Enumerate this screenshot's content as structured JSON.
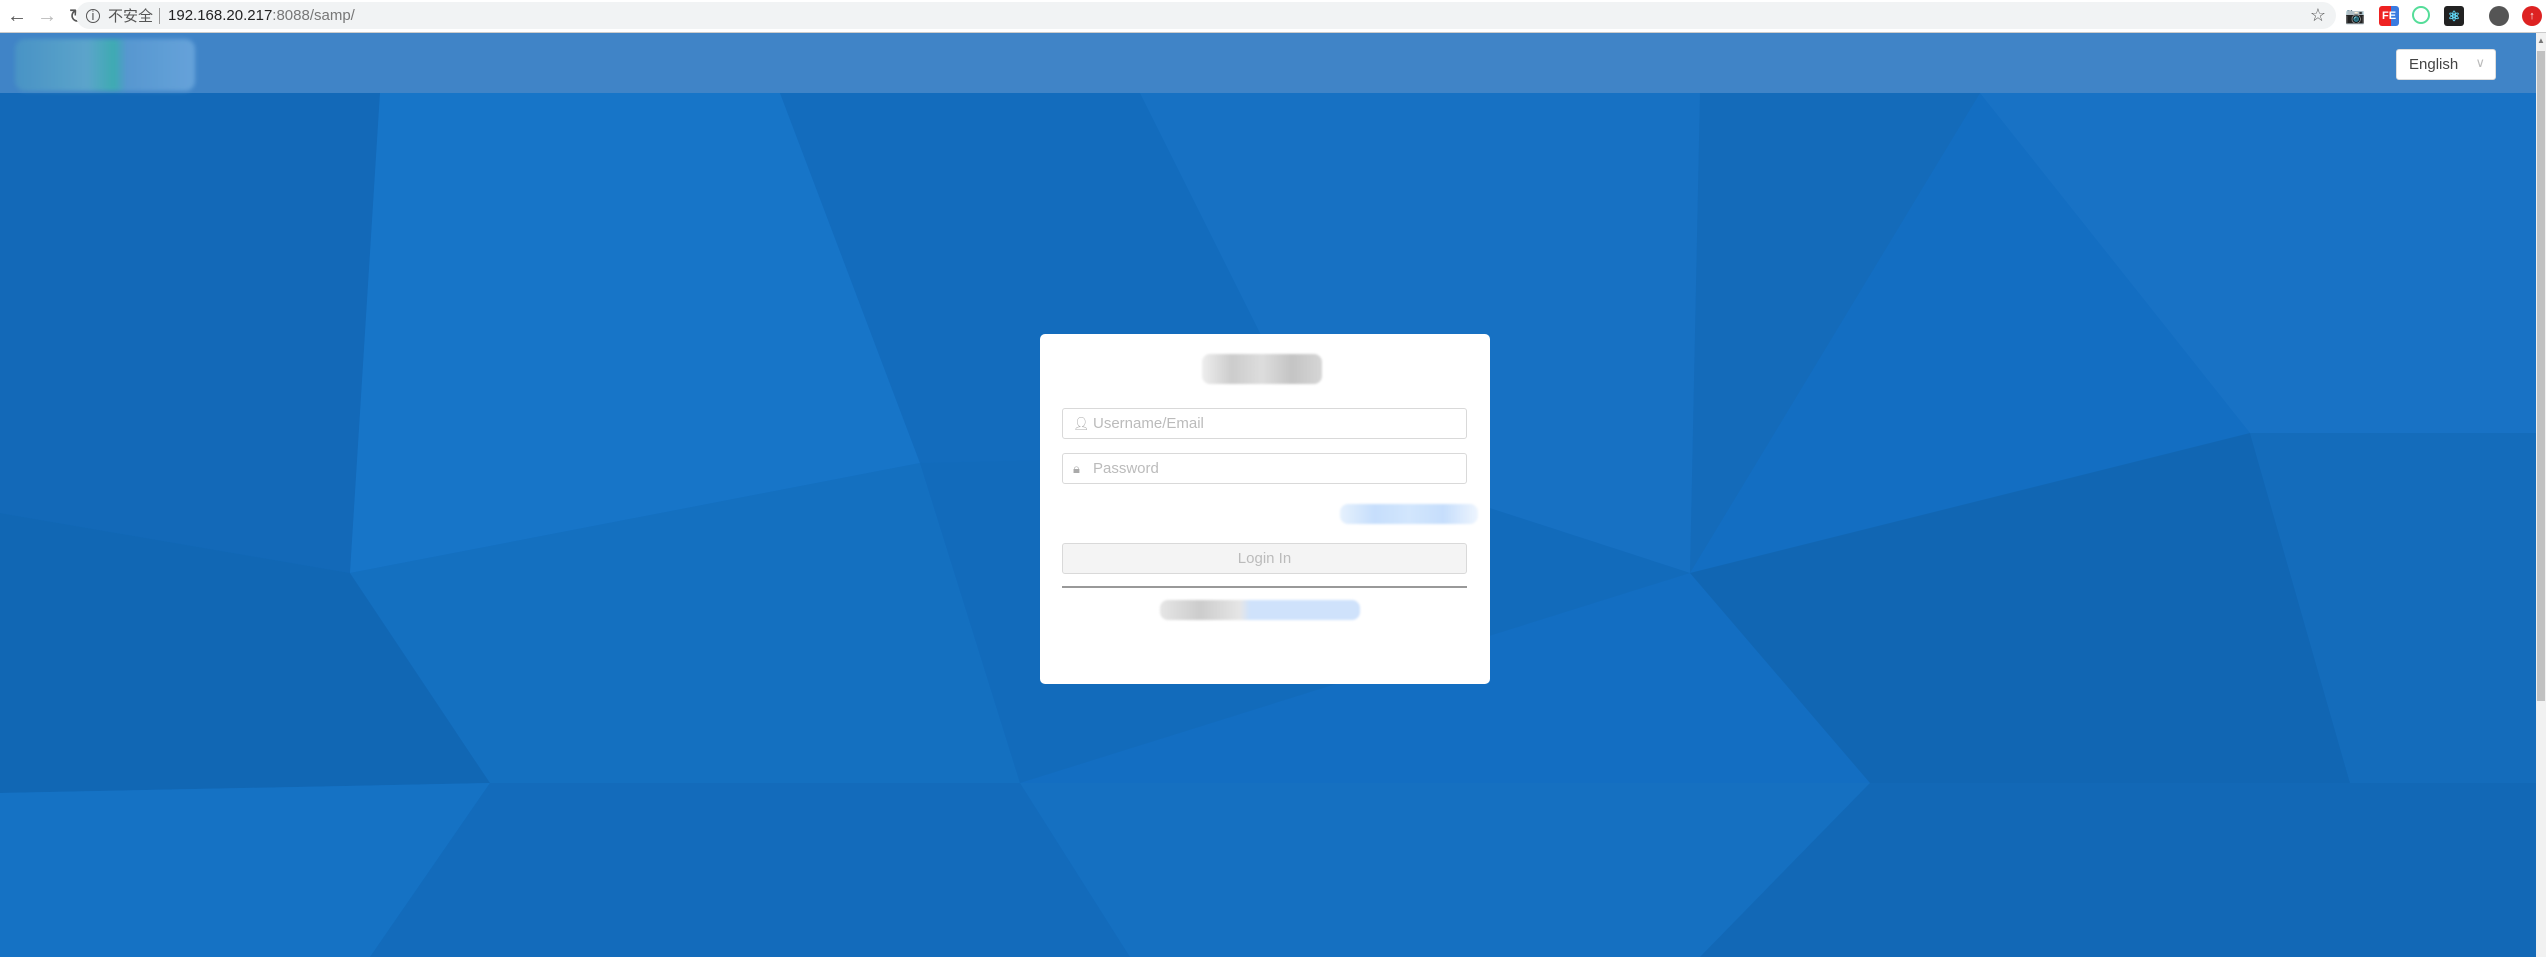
{
  "browser": {
    "security_label": "不安全",
    "url_host": "192.168.20.217",
    "url_path": ":8088/samp/",
    "extensions": [
      "camera-icon",
      "fe-extension-icon",
      "radar-extension-icon",
      "react-devtools-icon",
      "profile-icon",
      "update-icon"
    ]
  },
  "header": {
    "language": "English"
  },
  "login": {
    "username_placeholder": "Username/Email",
    "password_placeholder": "Password",
    "login_button": "Login In"
  },
  "colors": {
    "background": "#136ec2",
    "header": "#3a80c2",
    "card": "#ffffff"
  }
}
